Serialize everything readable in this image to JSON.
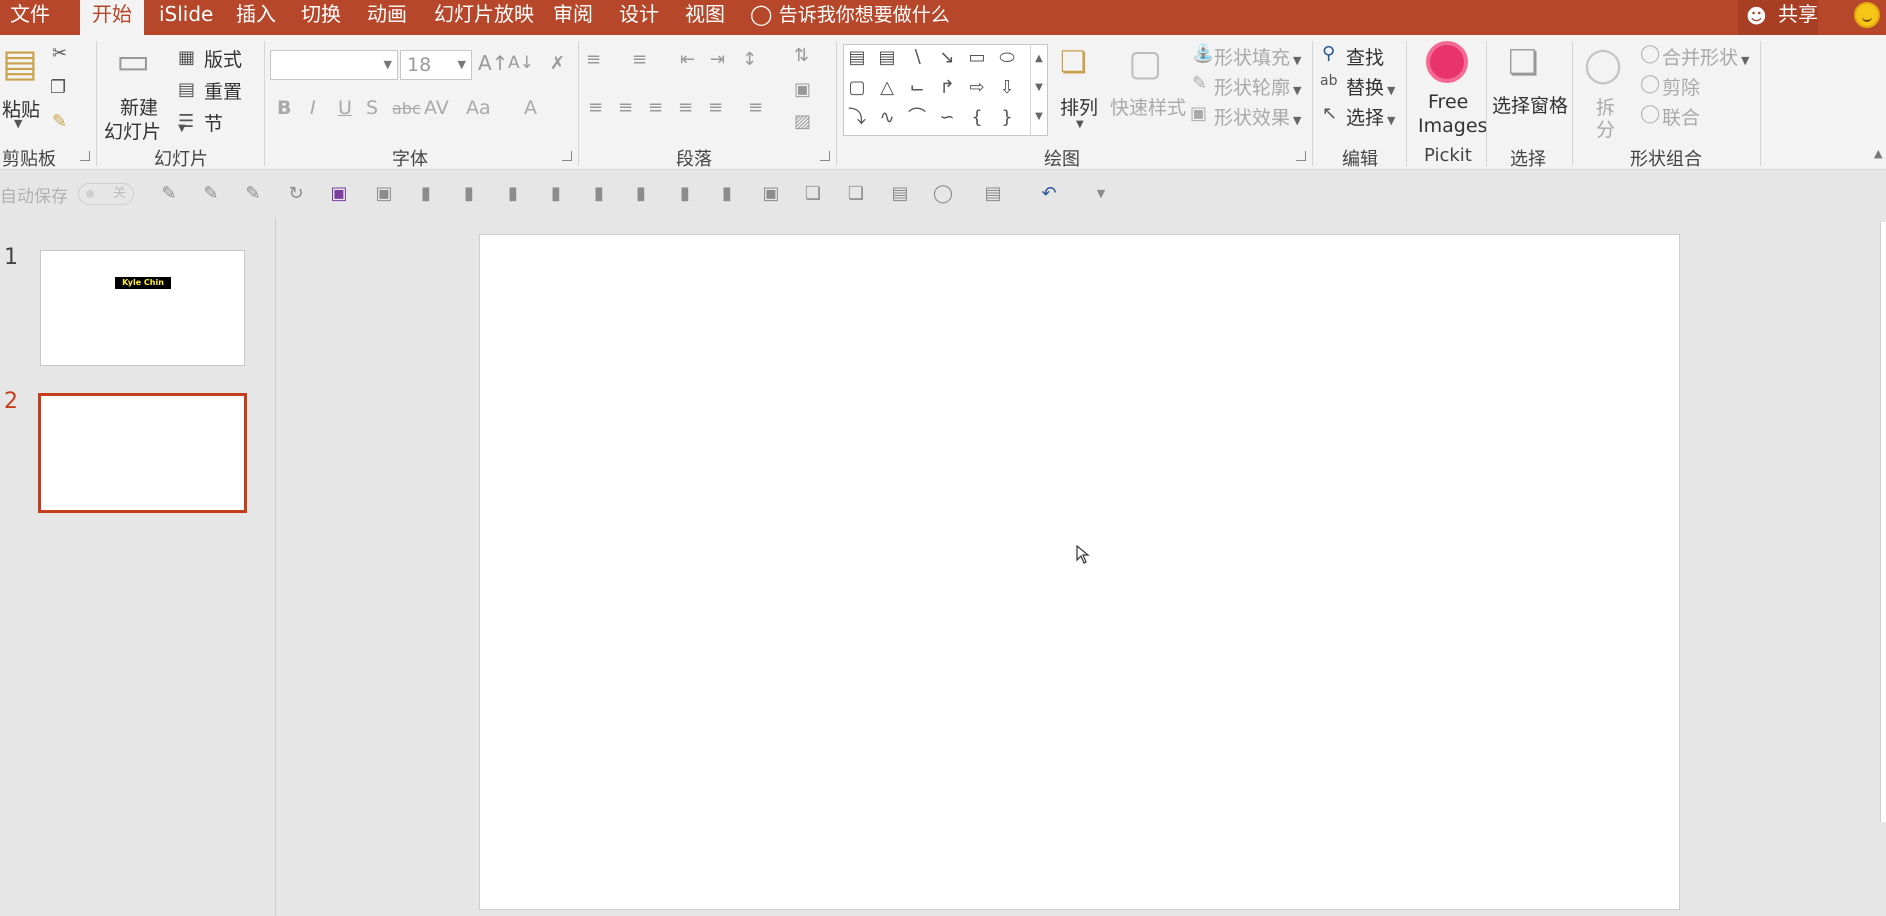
{
  "menubar": {
    "tabs": [
      "文件",
      "开始",
      "iSlide",
      "插入",
      "切换",
      "动画",
      "幻灯片放映",
      "审阅",
      "设计",
      "视图"
    ],
    "active_tab": "开始",
    "tell_me": "告诉我你想要做什么",
    "share": "共享",
    "bar_color": "#b7472a"
  },
  "ribbon": {
    "clipboard": {
      "label": "剪贴板",
      "paste": "粘贴"
    },
    "slides": {
      "label": "幻灯片",
      "new_slide_line1": "新建",
      "new_slide_line2": "幻灯片",
      "layout": "版式",
      "reset": "重置",
      "section": "节"
    },
    "font": {
      "label": "字体",
      "font_name": "",
      "font_size": "18",
      "bold": "B",
      "italic": "I",
      "underline": "U",
      "strike": "S",
      "strikethrough": "abc",
      "spacing": "AV",
      "case": "Aa",
      "color": "A"
    },
    "paragraph": {
      "label": "段落"
    },
    "drawing": {
      "label": "绘图",
      "arrange": "排列",
      "quick_styles": "快速样式",
      "shape_fill": "形状填充",
      "shape_outline": "形状轮廓",
      "shape_effects": "形状效果"
    },
    "editing": {
      "label": "编辑",
      "find": "查找",
      "replace": "替换",
      "select": "选择"
    },
    "pickit": {
      "label": "Pickit",
      "free_line1": "Free",
      "free_line2": "Images"
    },
    "selection": {
      "label": "选择",
      "pane": "选择窗格"
    },
    "shape_combine": {
      "label": "形状组合",
      "split_line1": "拆",
      "split_line2": "分",
      "merge": "合并形状",
      "subtract": "剪除",
      "union": "联合"
    }
  },
  "qat": {
    "autosave": "自动保存",
    "autosave_state": "关"
  },
  "slides": [
    {
      "number": "1",
      "title": "Kyle Chin",
      "active": false
    },
    {
      "number": "2",
      "title": "",
      "active": true
    }
  ]
}
